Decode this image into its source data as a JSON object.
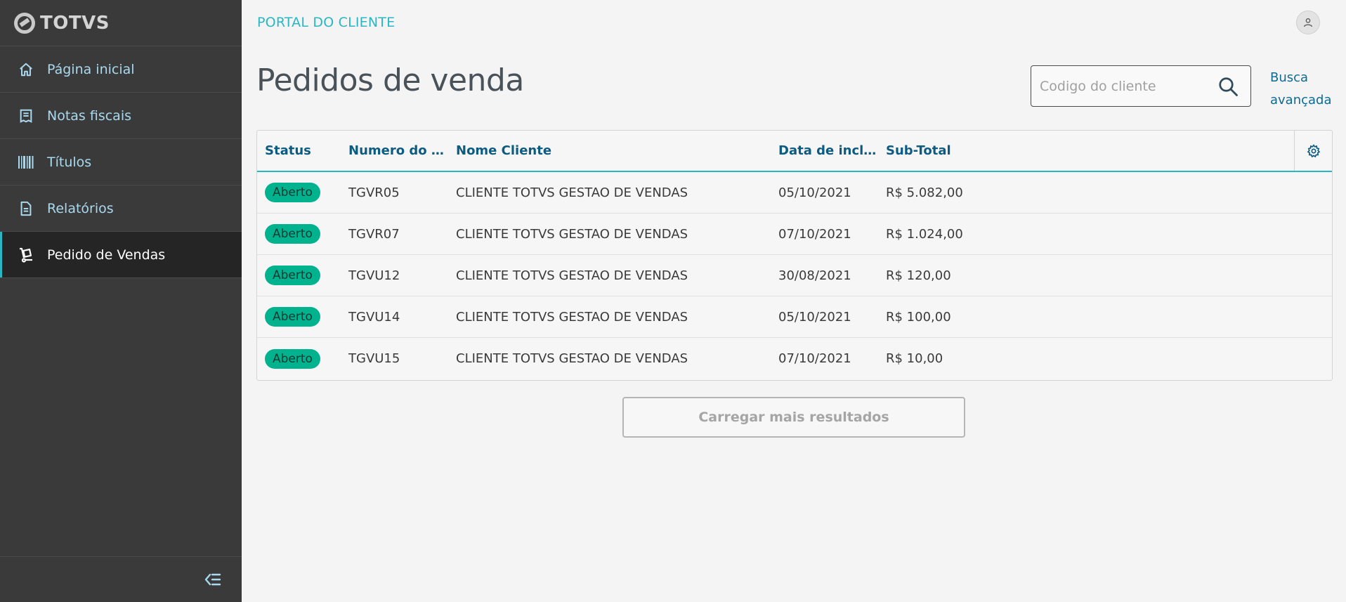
{
  "logo": {
    "text": "TOTVS"
  },
  "sidebar": {
    "items": [
      {
        "label": "Página inicial",
        "icon": "home-icon"
      },
      {
        "label": "Notas fiscais",
        "icon": "invoice-icon"
      },
      {
        "label": "Títulos",
        "icon": "barcode-icon"
      },
      {
        "label": "Relatórios",
        "icon": "document-icon"
      },
      {
        "label": "Pedido de Vendas",
        "icon": "hand-truck-icon",
        "active": true
      }
    ],
    "collapse_icon": "collapse-menu-icon"
  },
  "header": {
    "title": "PORTAL DO CLIENTE",
    "avatar_icon": "user-icon"
  },
  "page": {
    "title": "Pedidos de venda"
  },
  "search": {
    "placeholder": "Codigo do cliente",
    "value": "",
    "icon": "search-icon"
  },
  "advanced_search": {
    "line1": "Busca",
    "line2": "avançada"
  },
  "table": {
    "columns": [
      "Status",
      "Numero do P...",
      "Nome Cliente",
      "Data de inclu...",
      "Sub-Total"
    ],
    "settings_icon": "gear-icon",
    "rows": [
      {
        "status": "Aberto",
        "numero": "TGVR05",
        "nome": "CLIENTE TOTVS GESTAO DE VENDAS",
        "data": "05/10/2021",
        "subtotal": "R$ 5.082,00"
      },
      {
        "status": "Aberto",
        "numero": "TGVR07",
        "nome": "CLIENTE TOTVS GESTAO DE VENDAS",
        "data": "07/10/2021",
        "subtotal": "R$ 1.024,00"
      },
      {
        "status": "Aberto",
        "numero": "TGVU12",
        "nome": "CLIENTE TOTVS GESTAO DE VENDAS",
        "data": "30/08/2021",
        "subtotal": "R$ 120,00"
      },
      {
        "status": "Aberto",
        "numero": "TGVU14",
        "nome": "CLIENTE TOTVS GESTAO DE VENDAS",
        "data": "05/10/2021",
        "subtotal": "R$ 100,00"
      },
      {
        "status": "Aberto",
        "numero": "TGVU15",
        "nome": "CLIENTE TOTVS GESTAO DE VENDAS",
        "data": "07/10/2021",
        "subtotal": "R$ 10,00"
      }
    ]
  },
  "load_more": {
    "label": "Carregar mais resultados"
  },
  "colors": {
    "sidebar_bg": "#3a3a3a",
    "sidebar_active_bg": "#252525",
    "accent": "#29b6c5",
    "link": "#0c6c94",
    "status_open": "#00b28e"
  }
}
